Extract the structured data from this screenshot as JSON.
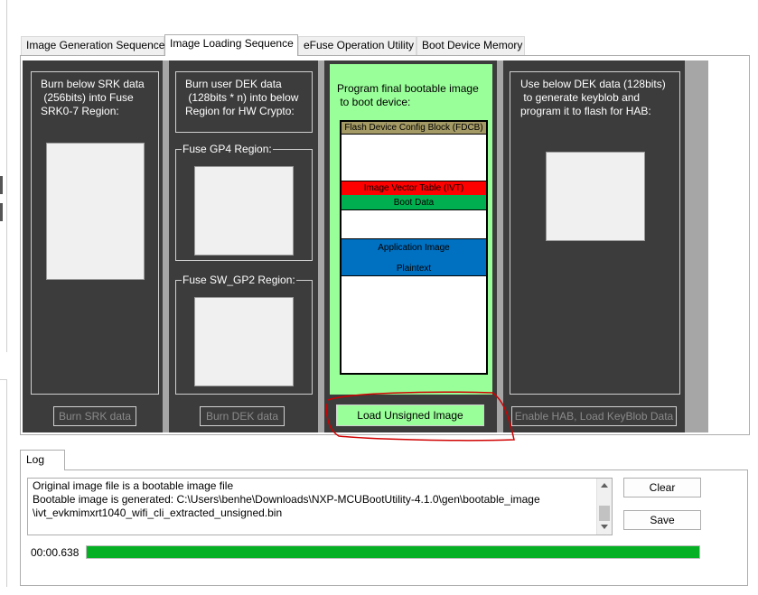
{
  "tabs": [
    {
      "label": "Image Generation Sequence",
      "active": false
    },
    {
      "label": "Image Loading Sequence",
      "active": true
    },
    {
      "label": "eFuse Operation Utility",
      "active": false
    },
    {
      "label": "Boot Device Memory",
      "active": false
    }
  ],
  "srk": {
    "title": "Burn below SRK data\n (256bits) into Fuse\nSRK0-7 Region:",
    "button": "Burn SRK data"
  },
  "dek": {
    "title": "Burn user DEK data\n (128bits * n) into below\nRegion for HW Crypto:",
    "gp4_label": "Fuse GP4 Region:",
    "swgp2_label": "Fuse SW_GP2 Region:",
    "button": "Burn DEK data"
  },
  "program": {
    "title": "Program final bootable image\n to boot device:",
    "fdcb": "Flash Device Config Block (FDCB)",
    "ivt": "Image Vector Table (IVT)",
    "boot_data": "Boot Data",
    "app_image": "Application Image",
    "plaintext": "Plaintext",
    "button": "Load Unsigned Image"
  },
  "hab": {
    "title": "Use below DEK data (128bits)\n to generate keyblob and\nprogram it to flash for HAB:",
    "button": "Enable HAB, Load KeyBlob Data"
  },
  "log": {
    "tab_label": "Log",
    "lines": [
      "Original image file is a bootable image file",
      "Bootable image is generated: C:\\Users\\benhe\\Downloads\\NXP-MCUBootUtility-4.1.0\\gen\\bootable_image",
      "\\ivt_evkmimxrt1040_wifi_cli_extracted_unsigned.bin"
    ],
    "clear_button": "Clear",
    "save_button": "Save",
    "elapsed": "00:00.638",
    "progress": 1.0
  },
  "colors": {
    "panel_dark": "#3c3c3c",
    "program_green": "#99ff99",
    "fdcb": "#a49a65",
    "ivt": "#ff0000",
    "boot_data": "#00b050",
    "app_image": "#0070c0",
    "progress": "#06b025",
    "annotation": "#d00000"
  }
}
